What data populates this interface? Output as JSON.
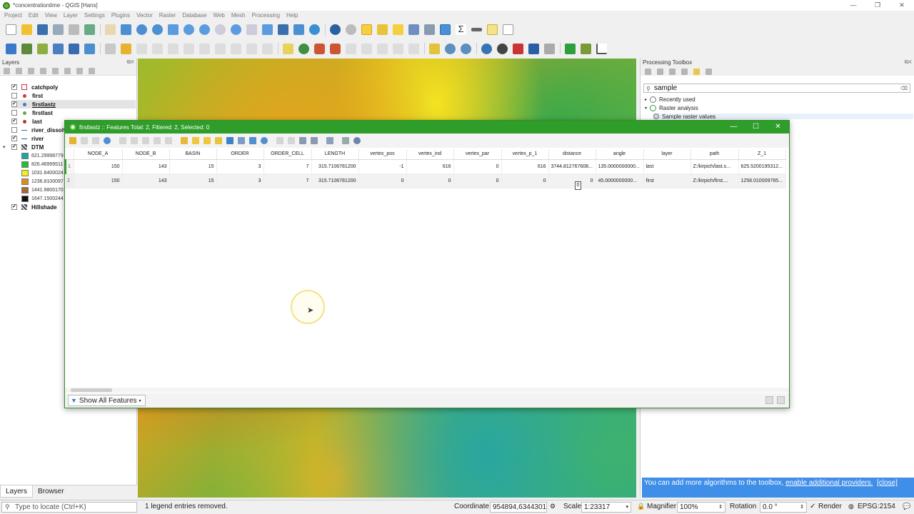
{
  "window": {
    "title": "*concentrationtime - QGIS [Hans]"
  },
  "menu": [
    "Project",
    "Edit",
    "View",
    "Layer",
    "Settings",
    "Plugins",
    "Vector",
    "Raster",
    "Database",
    "Web",
    "Mesh",
    "Processing",
    "Help"
  ],
  "layers_panel": {
    "title": "Layers",
    "layers": [
      {
        "name": "catchpoly",
        "checked": true,
        "color": "#cc3344"
      },
      {
        "name": "first",
        "checked": false,
        "color": "#d33"
      },
      {
        "name": "firstlastz",
        "checked": true,
        "color": "#4477cc"
      },
      {
        "name": "firstlast",
        "checked": false,
        "color": "#66aa44"
      },
      {
        "name": "last",
        "checked": true,
        "color": "#b33"
      },
      {
        "name": "river_dissolve",
        "checked": false,
        "color": "#3366bb"
      },
      {
        "name": "river",
        "checked": true,
        "color": "#2255aa"
      },
      {
        "name": "DTM",
        "checked": true,
        "color": "#555"
      },
      {
        "name": "Hillshade",
        "checked": true,
        "color": "#555"
      }
    ],
    "legend": [
      {
        "label": "621.29998779",
        "color": "#1aa7a4"
      },
      {
        "label": "826.46999511",
        "color": "#21c12d"
      },
      {
        "label": "1031.6400024",
        "color": "#f4ee20"
      },
      {
        "label": "1236.8100097",
        "color": "#e28a1e"
      },
      {
        "label": "1441.9800170",
        "color": "#a8683a"
      },
      {
        "label": "1647.1500244",
        "color": "#111111"
      }
    ],
    "tabs": [
      "Layers",
      "Browser"
    ]
  },
  "processing": {
    "title": "Processing Toolbox",
    "search_value": "sample",
    "tree": [
      "Recently used",
      "Raster analysis",
      "Sample raster values"
    ],
    "info_text": "You can add more algorithms to the toolbox,",
    "info_link": "enable additional providers.",
    "info_close": "[close]"
  },
  "attribute_table": {
    "title": "firstlastz :: Features Total: 2, Filtered: 2, Selected: 0",
    "columns": [
      "NODE_A",
      "NODE_B",
      "BASIN",
      "ORDER",
      "ORDER_CELL",
      "LENGTH",
      "vertex_pos",
      "vertex_ind",
      "vertex_par",
      "vertex_p_1",
      "distance",
      "angle",
      "layer",
      "path",
      "Z_1"
    ],
    "rows": [
      {
        "id": "1",
        "cells": [
          "150",
          "143",
          "15",
          "3",
          "7",
          "315.7106781200",
          "-1",
          "616",
          "0",
          "616",
          "3744.812767608...",
          "135.0000000000...",
          "last",
          "Z:/kirpich/last.s...",
          "625.5200195312..."
        ]
      },
      {
        "id": "2",
        "cells": [
          "150",
          "143",
          "15",
          "3",
          "7",
          "315.7106781200",
          "0",
          "0",
          "0",
          "0",
          "0",
          "45.0000000000...",
          "first",
          "Z:/kirpich/first....",
          "1258.010009765..."
        ]
      }
    ],
    "edit_badge": "0",
    "show_all": "Show All Features"
  },
  "statusbar": {
    "locator_placeholder": "Type to locate (Ctrl+K)",
    "message": "1 legend entries removed.",
    "coordinate_label": "Coordinate",
    "coordinate_value": "954894,6344301",
    "scale_label": "Scale",
    "scale_value": "1:23317",
    "magnifier_label": "Magnifier",
    "magnifier_value": "100%",
    "rotation_label": "Rotation",
    "rotation_value": "0.0 °",
    "render_label": "Render",
    "crs": "EPSG:2154"
  }
}
